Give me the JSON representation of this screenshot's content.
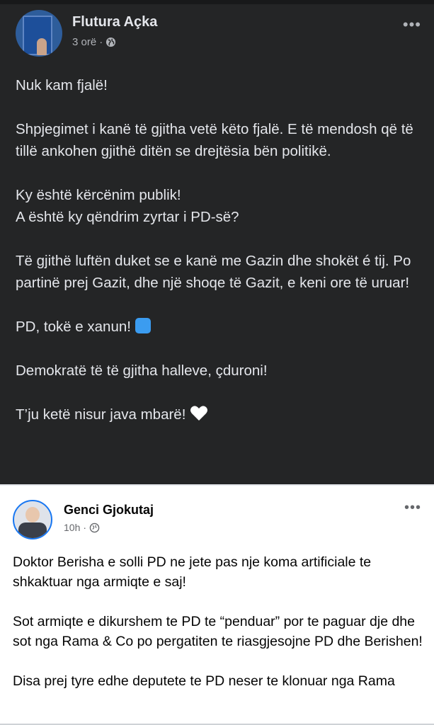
{
  "post1": {
    "author": "Flutura Açka",
    "time": "3 orë",
    "separator": "·",
    "more": "•••",
    "paragraphs": [
      "Nuk kam fjalë!",
      "Shpjegimet i kanë të gjitha vetë këto fjalë. E të mendosh që të tillë ankohen gjithë ditën se drejtësia bën politikë.",
      "Ky është kërcënim publik!",
      "A është ky qëndrim zyrtar i PD-së?",
      "Të gjithë luftën duket se e kanë me Gazin dhe shokët é tij. Po partinë prej Gazit, dhe një shoqe të Gazit, e keni ore të uruar!",
      "PD, tokë e xanun!",
      "Demokratë të të gjitha halleve, çduroni!",
      "T’ju ketë nisur java mbarë!"
    ]
  },
  "post2": {
    "author": "Genci Gjokutaj",
    "time": "10h",
    "separator": "·",
    "more": "•••",
    "paragraphs": [
      "Doktor Berisha e solli PD ne jete pas nje koma artificiale te shkaktuar nga armiqte e saj!",
      "Sot armiqte e dikurshem te PD te “penduar” por te paguar dje dhe sot nga Rama & Co po pergatiten te riasgjesojne PD dhe Berishen!",
      "Disa prej tyre edhe deputete te PD  neser te klonuar nga Rama"
    ]
  },
  "colors": {
    "dark_bg": "#242526",
    "dark_text": "#e4e6eb",
    "light_bg": "#ffffff",
    "light_text": "#050505",
    "accent": "#1877f2"
  },
  "icons": [
    "globe-icon",
    "more-icon",
    "blue-square-emoji-icon",
    "white-heart-emoji-icon"
  ]
}
